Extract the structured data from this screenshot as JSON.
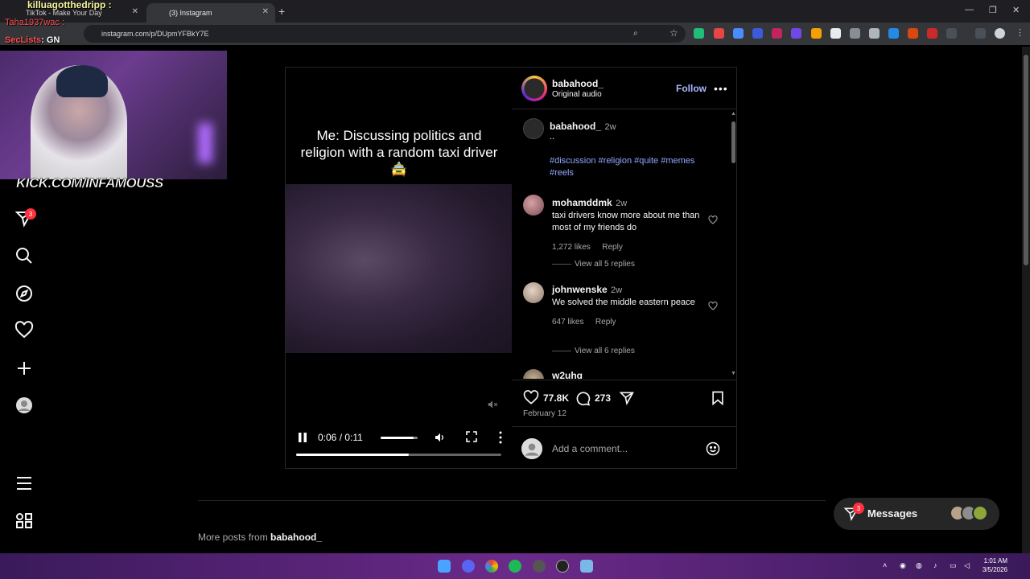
{
  "browser": {
    "tabs": [
      {
        "label": "TikTok - Make Your Day"
      },
      {
        "label": "(3) Instagram"
      }
    ],
    "url": "instagram.com/p/DUpmYFBkY7E"
  },
  "stream_overlay": {
    "line1": "killuagotthedripp :",
    "line2": "Taha1937wac :",
    "line3_user": "SecLists",
    "line3_text": ": GN",
    "kick_banner": "KICK.COM/INFAMOUSS"
  },
  "sidebar": {
    "notifications_badge": "3"
  },
  "post": {
    "video_caption": "Me: Discussing politics and religion with a random taxi driver 🚖",
    "time": "0:06 / 0:11",
    "progress_fraction": 0.55,
    "volume_fraction": 0.9,
    "author": "babahood_",
    "audio": "Original audio",
    "follow_label": "Follow",
    "caption": {
      "user": "babahood_",
      "time": "2w",
      "text": "..",
      "hashtags": "#discussion #religion #quite #memes #reels"
    },
    "comments": [
      {
        "user": "mohamddmk",
        "time": "2w",
        "text": "taxi drivers know more about me than most of my friends do",
        "likes": "1,272 likes",
        "reply": "Reply",
        "view_replies": "View all 5 replies"
      },
      {
        "user": "johnwenske",
        "time": "2w",
        "text": "We solved the middle eastern peace",
        "likes": "647 likes",
        "reply": "Reply",
        "view_replies": "View all 6 replies"
      },
      {
        "user": "w2uhq"
      }
    ],
    "like_count": "77.8K",
    "comment_count": "273",
    "date": "February 12",
    "comment_placeholder": "Add a comment..."
  },
  "page": {
    "more_posts_prefix": "More posts from",
    "more_posts_user": "babahood_"
  },
  "messages": {
    "label": "Messages",
    "badge": "3"
  },
  "taskbar": {
    "time": "1:01 AM",
    "date": "3/5/2026"
  },
  "colors": {
    "instagram_blue_link": "#a6b8ff",
    "hashtag": "#8fa8ff",
    "badge_red": "#ff3040"
  }
}
